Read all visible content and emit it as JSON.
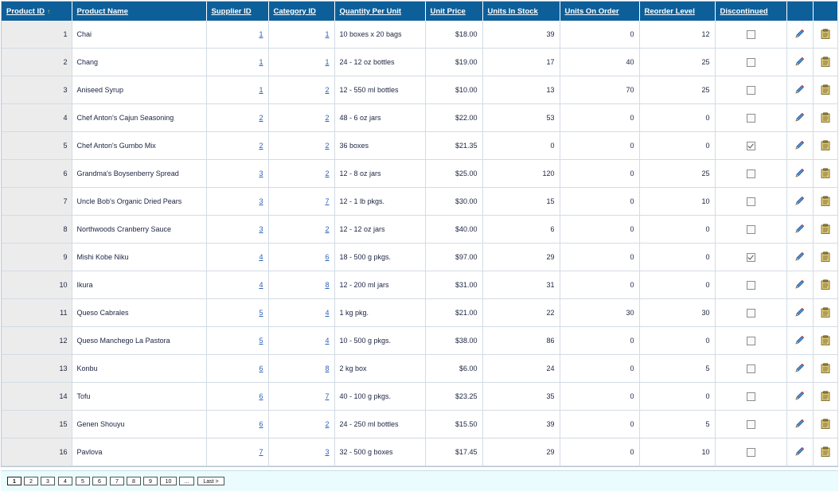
{
  "columns": [
    {
      "label": "Product ID",
      "sorted": true
    },
    {
      "label": "Product Name"
    },
    {
      "label": "Supplier ID"
    },
    {
      "label": "Category ID"
    },
    {
      "label": "Quantity Per Unit"
    },
    {
      "label": "Unit Price"
    },
    {
      "label": "Units In Stock"
    },
    {
      "label": "Units On Order"
    },
    {
      "label": "Reorder Level"
    },
    {
      "label": "Discontinued"
    }
  ],
  "sort_indicator": "↑",
  "rows": [
    {
      "id": "1",
      "name": "Chai",
      "supplier": "1",
      "category": "1",
      "qty": "10 boxes x 20 bags",
      "price": "$18.00",
      "stock": "39",
      "order": "0",
      "reorder": "12",
      "discontinued": false
    },
    {
      "id": "2",
      "name": "Chang",
      "supplier": "1",
      "category": "1",
      "qty": "24 - 12 oz bottles",
      "price": "$19.00",
      "stock": "17",
      "order": "40",
      "reorder": "25",
      "discontinued": false
    },
    {
      "id": "3",
      "name": "Aniseed Syrup",
      "supplier": "1",
      "category": "2",
      "qty": "12 - 550 ml bottles",
      "price": "$10.00",
      "stock": "13",
      "order": "70",
      "reorder": "25",
      "discontinued": false
    },
    {
      "id": "4",
      "name": "Chef Anton's Cajun Seasoning",
      "supplier": "2",
      "category": "2",
      "qty": "48 - 6 oz jars",
      "price": "$22.00",
      "stock": "53",
      "order": "0",
      "reorder": "0",
      "discontinued": false
    },
    {
      "id": "5",
      "name": "Chef Anton's Gumbo Mix",
      "supplier": "2",
      "category": "2",
      "qty": "36 boxes",
      "price": "$21.35",
      "stock": "0",
      "order": "0",
      "reorder": "0",
      "discontinued": true
    },
    {
      "id": "6",
      "name": "Grandma's Boysenberry Spread",
      "supplier": "3",
      "category": "2",
      "qty": "12 - 8 oz jars",
      "price": "$25.00",
      "stock": "120",
      "order": "0",
      "reorder": "25",
      "discontinued": false
    },
    {
      "id": "7",
      "name": "Uncle Bob's Organic Dried Pears",
      "supplier": "3",
      "category": "7",
      "qty": "12 - 1 lb pkgs.",
      "price": "$30.00",
      "stock": "15",
      "order": "0",
      "reorder": "10",
      "discontinued": false
    },
    {
      "id": "8",
      "name": "Northwoods Cranberry Sauce",
      "supplier": "3",
      "category": "2",
      "qty": "12 - 12 oz jars",
      "price": "$40.00",
      "stock": "6",
      "order": "0",
      "reorder": "0",
      "discontinued": false
    },
    {
      "id": "9",
      "name": "Mishi Kobe Niku",
      "supplier": "4",
      "category": "6",
      "qty": "18 - 500 g pkgs.",
      "price": "$97.00",
      "stock": "29",
      "order": "0",
      "reorder": "0",
      "discontinued": true
    },
    {
      "id": "10",
      "name": "Ikura",
      "supplier": "4",
      "category": "8",
      "qty": "12 - 200 ml jars",
      "price": "$31.00",
      "stock": "31",
      "order": "0",
      "reorder": "0",
      "discontinued": false
    },
    {
      "id": "11",
      "name": "Queso Cabrales",
      "supplier": "5",
      "category": "4",
      "qty": "1 kg pkg.",
      "price": "$21.00",
      "stock": "22",
      "order": "30",
      "reorder": "30",
      "discontinued": false
    },
    {
      "id": "12",
      "name": "Queso Manchego La Pastora",
      "supplier": "5",
      "category": "4",
      "qty": "10 - 500 g pkgs.",
      "price": "$38.00",
      "stock": "86",
      "order": "0",
      "reorder": "0",
      "discontinued": false
    },
    {
      "id": "13",
      "name": "Konbu",
      "supplier": "6",
      "category": "8",
      "qty": "2 kg box",
      "price": "$6.00",
      "stock": "24",
      "order": "0",
      "reorder": "5",
      "discontinued": false
    },
    {
      "id": "14",
      "name": "Tofu",
      "supplier": "6",
      "category": "7",
      "qty": "40 - 100 g pkgs.",
      "price": "$23.25",
      "stock": "35",
      "order": "0",
      "reorder": "0",
      "discontinued": false
    },
    {
      "id": "15",
      "name": "Genen Shouyu",
      "supplier": "6",
      "category": "2",
      "qty": "24 - 250 ml bottles",
      "price": "$15.50",
      "stock": "39",
      "order": "0",
      "reorder": "5",
      "discontinued": false
    },
    {
      "id": "16",
      "name": "Pavlova",
      "supplier": "7",
      "category": "3",
      "qty": "32 - 500 g boxes",
      "price": "$17.45",
      "stock": "29",
      "order": "0",
      "reorder": "10",
      "discontinued": false
    }
  ],
  "row_actions": {
    "edit_icon": "pencil-icon",
    "delete_icon": "clipboard-icon"
  },
  "pager": {
    "pages": [
      "1",
      "2",
      "3",
      "4",
      "5",
      "6",
      "7",
      "8",
      "9",
      "10",
      "...",
      "Last >"
    ],
    "current": "1"
  },
  "colors": {
    "header_bg": "#0d5f9a",
    "id_cell_bg": "#ececec",
    "pager_bg": "#eafcfd",
    "link": "#2a62b8"
  }
}
